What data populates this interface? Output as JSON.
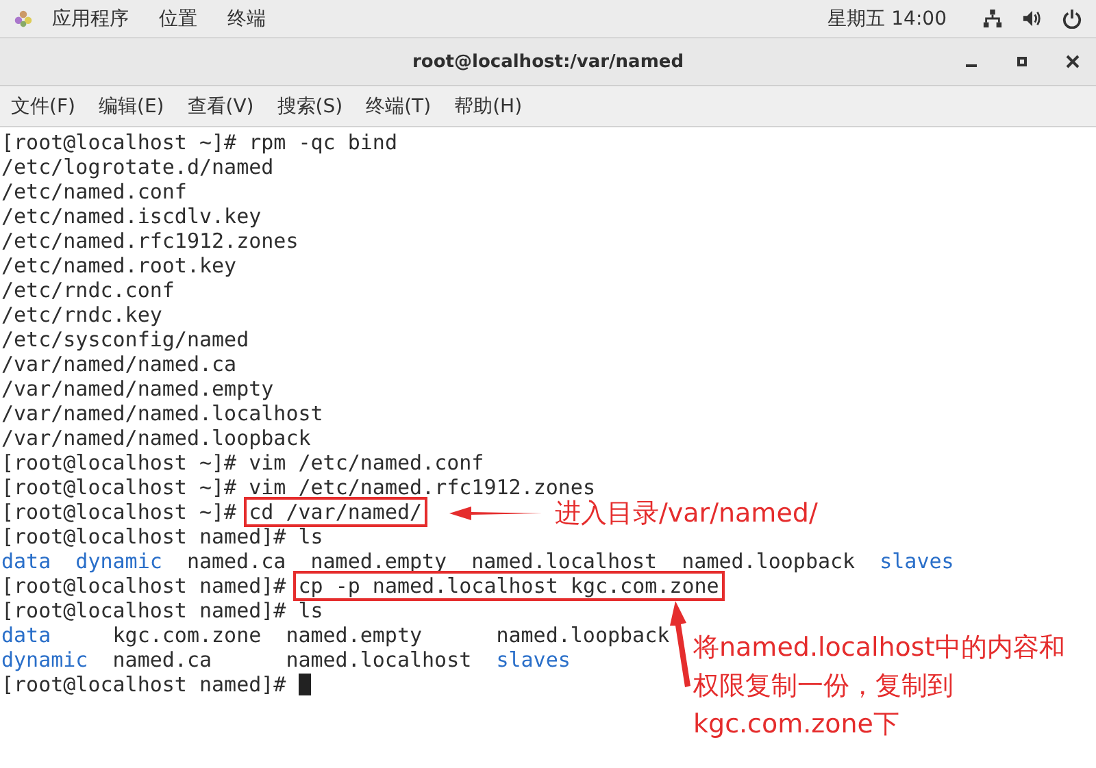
{
  "top_bar": {
    "menus": [
      "应用程序",
      "位置",
      "终端"
    ],
    "clock": "星期五 14:00"
  },
  "window": {
    "title": "root@localhost:/var/named"
  },
  "menu_bar": [
    "文件(F)",
    "编辑(E)",
    "查看(V)",
    "搜索(S)",
    "终端(T)",
    "帮助(H)"
  ],
  "terminal": {
    "lines": [
      {
        "kind": "cmd",
        "prompt": "[root@localhost ~]# ",
        "command": "rpm -qc bind",
        "highlighted": false
      },
      {
        "kind": "out",
        "text": "/etc/logrotate.d/named"
      },
      {
        "kind": "out",
        "text": "/etc/named.conf"
      },
      {
        "kind": "out",
        "text": "/etc/named.iscdlv.key"
      },
      {
        "kind": "out",
        "text": "/etc/named.rfc1912.zones"
      },
      {
        "kind": "out",
        "text": "/etc/named.root.key"
      },
      {
        "kind": "out",
        "text": "/etc/rndc.conf"
      },
      {
        "kind": "out",
        "text": "/etc/rndc.key"
      },
      {
        "kind": "out",
        "text": "/etc/sysconfig/named"
      },
      {
        "kind": "out",
        "text": "/var/named/named.ca"
      },
      {
        "kind": "out",
        "text": "/var/named/named.empty"
      },
      {
        "kind": "out",
        "text": "/var/named/named.localhost"
      },
      {
        "kind": "out",
        "text": "/var/named/named.loopback"
      },
      {
        "kind": "cmd",
        "prompt": "[root@localhost ~]# ",
        "command": "vim /etc/named.conf",
        "highlighted": false
      },
      {
        "kind": "cmd",
        "prompt": "[root@localhost ~]# ",
        "command": "vim /etc/named.rfc1912.zones",
        "highlighted": false
      },
      {
        "kind": "cmd",
        "prompt": "[root@localhost ~]# ",
        "command": "cd /var/named/",
        "highlighted": true
      },
      {
        "kind": "cmd",
        "prompt": "[root@localhost named]# ",
        "command": "ls",
        "highlighted": false
      },
      {
        "kind": "ls",
        "rows": [
          [
            {
              "name": "data",
              "kind": "dir"
            },
            {
              "name": "dynamic",
              "kind": "dir"
            },
            {
              "name": "named.ca",
              "kind": "file"
            },
            {
              "name": "named.empty",
              "kind": "file"
            },
            {
              "name": "named.localhost",
              "kind": "file"
            },
            {
              "name": "named.loopback",
              "kind": "file"
            },
            {
              "name": "slaves",
              "kind": "dir"
            }
          ]
        ]
      },
      {
        "kind": "cmd",
        "prompt": "[root@localhost named]# ",
        "command": "cp -p named.localhost kgc.com.zone",
        "highlighted": true
      },
      {
        "kind": "cmd",
        "prompt": "[root@localhost named]# ",
        "command": "ls",
        "highlighted": false
      },
      {
        "kind": "ls",
        "rows": [
          [
            {
              "name": "data",
              "kind": "dir"
            },
            {
              "name": "kgc.com.zone",
              "kind": "file"
            },
            {
              "name": "named.empty",
              "kind": "file"
            },
            {
              "name": "named.loopback",
              "kind": "file"
            }
          ],
          [
            {
              "name": "dynamic",
              "kind": "dir"
            },
            {
              "name": "named.ca",
              "kind": "file"
            },
            {
              "name": "named.localhost",
              "kind": "file"
            },
            {
              "name": "slaves",
              "kind": "dir"
            }
          ]
        ]
      },
      {
        "kind": "cmd",
        "prompt": "[root@localhost named]# ",
        "cursor": true
      }
    ]
  },
  "annotations": [
    {
      "kind": "left",
      "lines": [
        "进入目录/var/named/"
      ]
    },
    {
      "kind": "up",
      "lines": [
        "将named.localhost中的内容和",
        "权限复制一份，复制到",
        "kgc.com.zone下"
      ]
    }
  ]
}
